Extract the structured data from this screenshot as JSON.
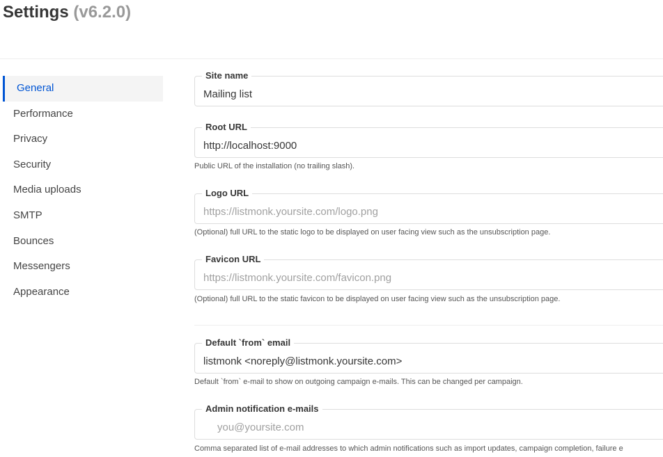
{
  "header": {
    "title": "Settings",
    "version": "(v6.2.0)"
  },
  "sidebar": {
    "items": [
      {
        "label": "General",
        "active": true
      },
      {
        "label": "Performance"
      },
      {
        "label": "Privacy"
      },
      {
        "label": "Security"
      },
      {
        "label": "Media uploads"
      },
      {
        "label": "SMTP"
      },
      {
        "label": "Bounces"
      },
      {
        "label": "Messengers"
      },
      {
        "label": "Appearance"
      }
    ]
  },
  "general": {
    "site_name": {
      "label": "Site name",
      "value": "Mailing list"
    },
    "root_url": {
      "label": "Root URL",
      "value": "http://localhost:9000",
      "help": "Public URL of the installation (no trailing slash)."
    },
    "logo_url": {
      "label": "Logo URL",
      "placeholder": "https://listmonk.yoursite.com/logo.png",
      "help": "(Optional) full URL to the static logo to be displayed on user facing view such as the unsubscription page."
    },
    "favicon_url": {
      "label": "Favicon URL",
      "placeholder": "https://listmonk.yoursite.com/favicon.png",
      "help": "(Optional) full URL to the static favicon to be displayed on user facing view such as the unsubscription page."
    },
    "from_email": {
      "label": "Default `from` email",
      "value": "listmonk <noreply@listmonk.yoursite.com>",
      "help": "Default `from` e-mail to show on outgoing campaign e-mails. This can be changed per campaign."
    },
    "admin_emails": {
      "label": "Admin notification e-mails",
      "placeholder": "you@yoursite.com",
      "help": "Comma separated list of e-mail addresses to which admin notifications such as import updates, campaign completion, failure e"
    }
  },
  "colors": {
    "accent": "#0055d4",
    "border": "#dddddd"
  }
}
